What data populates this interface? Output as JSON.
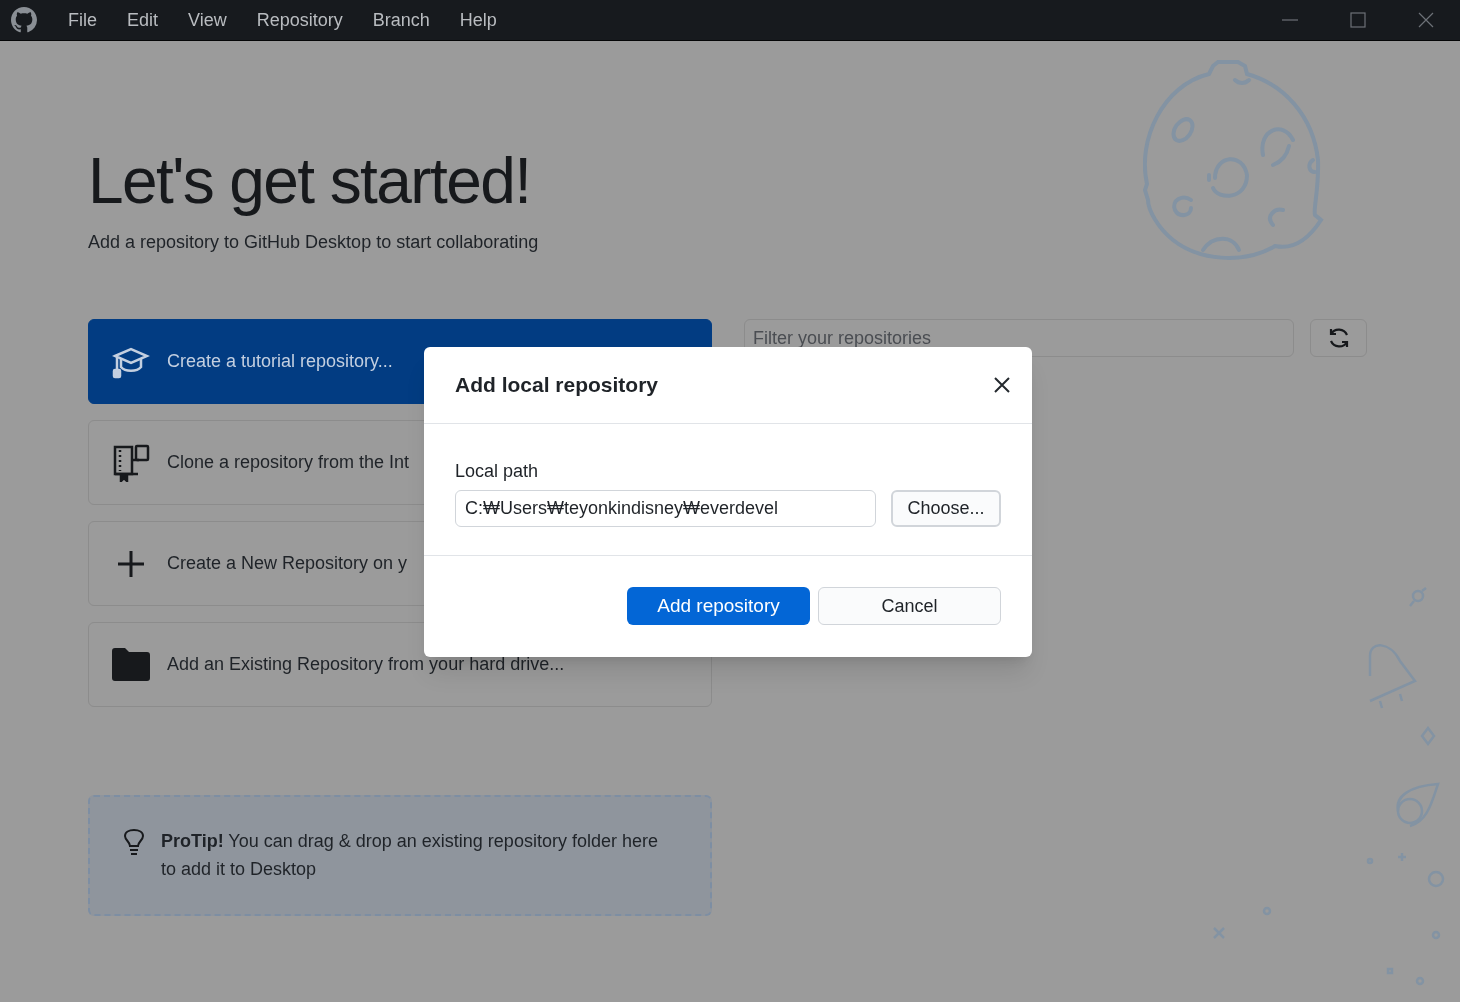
{
  "menu": [
    "File",
    "Edit",
    "View",
    "Repository",
    "Branch",
    "Help"
  ],
  "title": "Let's get started!",
  "subtitle": "Add a repository to GitHub Desktop to start collaborating",
  "actions": [
    {
      "kind": "tutorial",
      "label": "Create a tutorial repository...",
      "primary": true
    },
    {
      "kind": "clone",
      "label": "Clone a repository from the Int",
      "primary": false
    },
    {
      "kind": "create",
      "label": "Create a New Repository on y",
      "primary": false
    },
    {
      "kind": "add",
      "label": "Add an Existing Repository from your hard drive...",
      "primary": false
    }
  ],
  "filter": {
    "placeholder": "Filter your repositories"
  },
  "protip": "**ProTip!** You can drag & drop an existing repository folder here to add it to Desktop",
  "dialog": {
    "title": "Add local repository",
    "field_label": "Local path",
    "path": "C:₩Users₩teyonkindisney₩everdevel",
    "choose": "Choose...",
    "add": "Add repository",
    "cancel": "Cancel"
  }
}
